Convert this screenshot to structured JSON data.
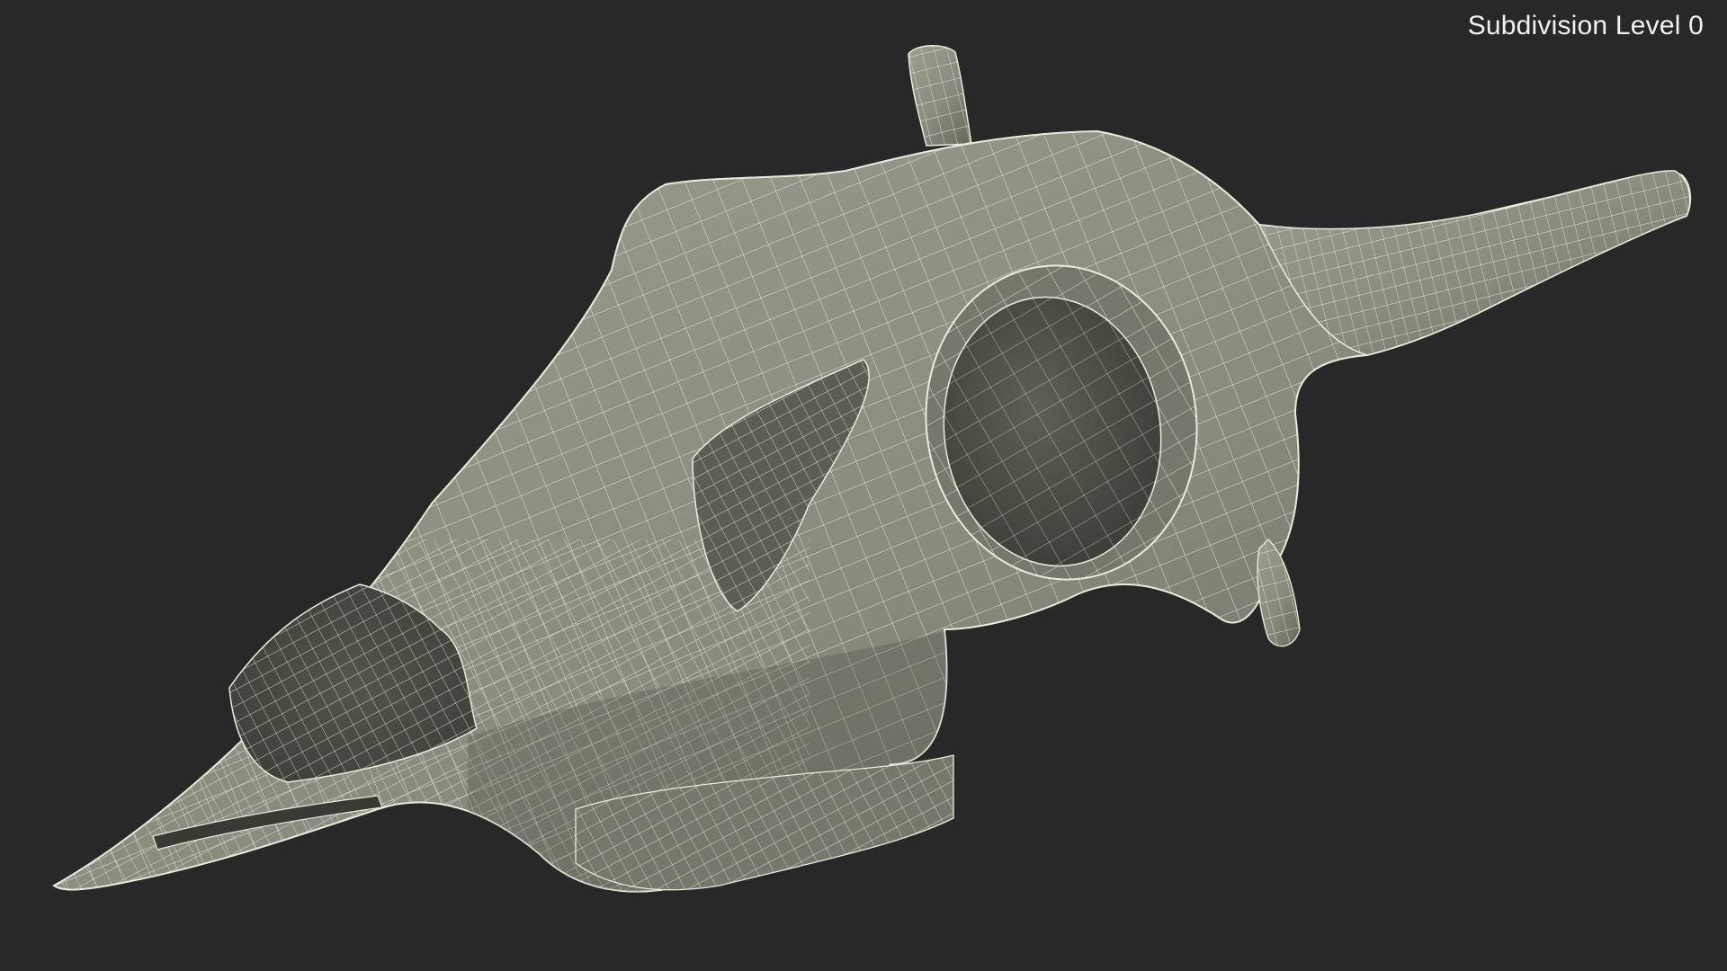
{
  "viewport": {
    "label": "Subdivision Level 0",
    "background_color": "#282828",
    "label_color": "#f2f2f2"
  },
  "model": {
    "name": "skull-wireframe",
    "surface_color": "#8f8f84",
    "wire_color": "#ece9dd",
    "cavity_color": "#4b4b44"
  }
}
